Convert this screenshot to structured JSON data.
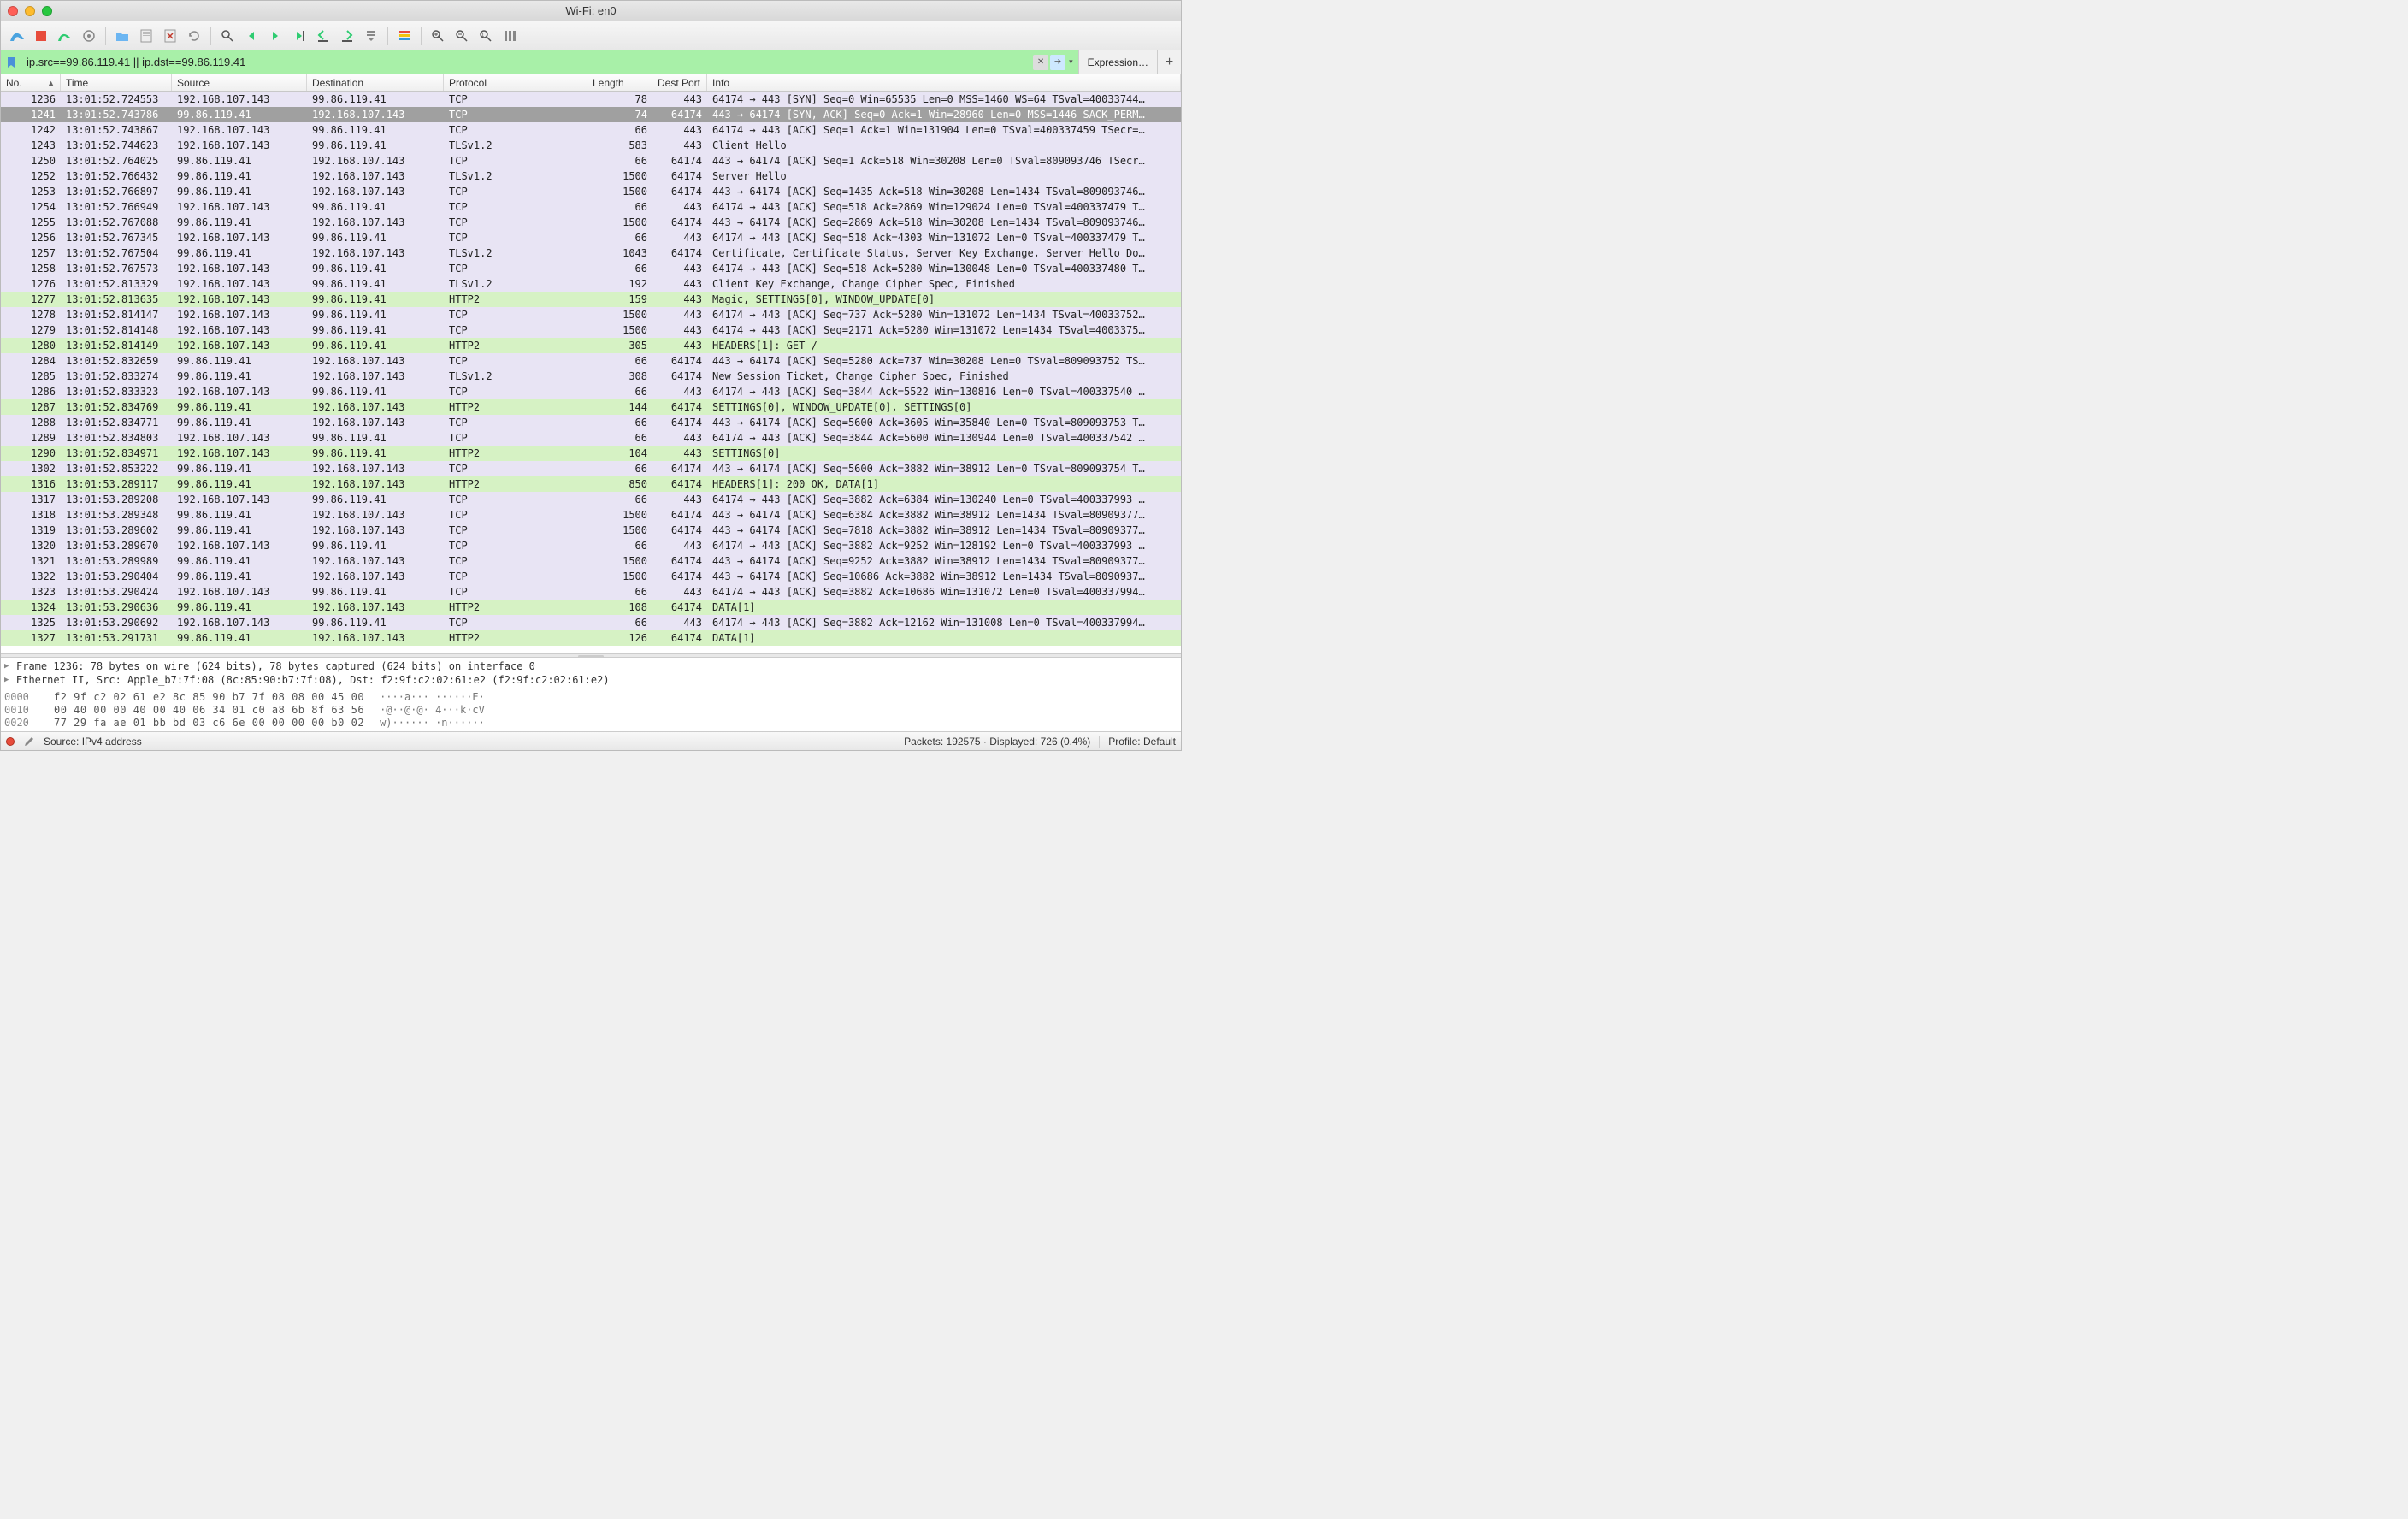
{
  "window": {
    "title": "Wi-Fi: en0"
  },
  "filter": {
    "value": "ip.src==99.86.119.41 || ip.dst==99.86.119.41",
    "expression_label": "Expression…"
  },
  "columns": {
    "no": "No.",
    "time": "Time",
    "source": "Source",
    "destination": "Destination",
    "protocol": "Protocol",
    "length": "Length",
    "dest_port": "Dest Port",
    "info": "Info"
  },
  "packets": [
    {
      "no": 1236,
      "time": "13:01:52.724553",
      "src": "192.168.107.143",
      "dst": "99.86.119.41",
      "proto": "TCP",
      "len": 78,
      "port": 443,
      "info": "64174 → 443 [SYN] Seq=0 Win=65535 Len=0 MSS=1460 WS=64 TSval=40033744…",
      "cls": "row-lav"
    },
    {
      "no": 1241,
      "time": "13:01:52.743786",
      "src": "99.86.119.41",
      "dst": "192.168.107.143",
      "proto": "TCP",
      "len": 74,
      "port": 64174,
      "info": "443 → 64174 [SYN, ACK] Seq=0 Ack=1 Win=28960 Len=0 MSS=1446 SACK_PERM…",
      "cls": "row-sel"
    },
    {
      "no": 1242,
      "time": "13:01:52.743867",
      "src": "192.168.107.143",
      "dst": "99.86.119.41",
      "proto": "TCP",
      "len": 66,
      "port": 443,
      "info": "64174 → 443 [ACK] Seq=1 Ack=1 Win=131904 Len=0 TSval=400337459 TSecr=…",
      "cls": "row-lav"
    },
    {
      "no": 1243,
      "time": "13:01:52.744623",
      "src": "192.168.107.143",
      "dst": "99.86.119.41",
      "proto": "TLSv1.2",
      "len": 583,
      "port": 443,
      "info": "Client Hello",
      "cls": "row-lav"
    },
    {
      "no": 1250,
      "time": "13:01:52.764025",
      "src": "99.86.119.41",
      "dst": "192.168.107.143",
      "proto": "TCP",
      "len": 66,
      "port": 64174,
      "info": "443 → 64174 [ACK] Seq=1 Ack=518 Win=30208 Len=0 TSval=809093746 TSecr…",
      "cls": "row-lav"
    },
    {
      "no": 1252,
      "time": "13:01:52.766432",
      "src": "99.86.119.41",
      "dst": "192.168.107.143",
      "proto": "TLSv1.2",
      "len": 1500,
      "port": 64174,
      "info": "Server Hello",
      "cls": "row-lav"
    },
    {
      "no": 1253,
      "time": "13:01:52.766897",
      "src": "99.86.119.41",
      "dst": "192.168.107.143",
      "proto": "TCP",
      "len": 1500,
      "port": 64174,
      "info": "443 → 64174 [ACK] Seq=1435 Ack=518 Win=30208 Len=1434 TSval=809093746…",
      "cls": "row-lav"
    },
    {
      "no": 1254,
      "time": "13:01:52.766949",
      "src": "192.168.107.143",
      "dst": "99.86.119.41",
      "proto": "TCP",
      "len": 66,
      "port": 443,
      "info": "64174 → 443 [ACK] Seq=518 Ack=2869 Win=129024 Len=0 TSval=400337479 T…",
      "cls": "row-lav"
    },
    {
      "no": 1255,
      "time": "13:01:52.767088",
      "src": "99.86.119.41",
      "dst": "192.168.107.143",
      "proto": "TCP",
      "len": 1500,
      "port": 64174,
      "info": "443 → 64174 [ACK] Seq=2869 Ack=518 Win=30208 Len=1434 TSval=809093746…",
      "cls": "row-lav"
    },
    {
      "no": 1256,
      "time": "13:01:52.767345",
      "src": "192.168.107.143",
      "dst": "99.86.119.41",
      "proto": "TCP",
      "len": 66,
      "port": 443,
      "info": "64174 → 443 [ACK] Seq=518 Ack=4303 Win=131072 Len=0 TSval=400337479 T…",
      "cls": "row-lav"
    },
    {
      "no": 1257,
      "time": "13:01:52.767504",
      "src": "99.86.119.41",
      "dst": "192.168.107.143",
      "proto": "TLSv1.2",
      "len": 1043,
      "port": 64174,
      "info": "Certificate, Certificate Status, Server Key Exchange, Server Hello Do…",
      "cls": "row-lav"
    },
    {
      "no": 1258,
      "time": "13:01:52.767573",
      "src": "192.168.107.143",
      "dst": "99.86.119.41",
      "proto": "TCP",
      "len": 66,
      "port": 443,
      "info": "64174 → 443 [ACK] Seq=518 Ack=5280 Win=130048 Len=0 TSval=400337480 T…",
      "cls": "row-lav"
    },
    {
      "no": 1276,
      "time": "13:01:52.813329",
      "src": "192.168.107.143",
      "dst": "99.86.119.41",
      "proto": "TLSv1.2",
      "len": 192,
      "port": 443,
      "info": "Client Key Exchange, Change Cipher Spec, Finished",
      "cls": "row-lav"
    },
    {
      "no": 1277,
      "time": "13:01:52.813635",
      "src": "192.168.107.143",
      "dst": "99.86.119.41",
      "proto": "HTTP2",
      "len": 159,
      "port": 443,
      "info": "Magic, SETTINGS[0], WINDOW_UPDATE[0]",
      "cls": "row-grn"
    },
    {
      "no": 1278,
      "time": "13:01:52.814147",
      "src": "192.168.107.143",
      "dst": "99.86.119.41",
      "proto": "TCP",
      "len": 1500,
      "port": 443,
      "info": "64174 → 443 [ACK] Seq=737 Ack=5280 Win=131072 Len=1434 TSval=40033752…",
      "cls": "row-lav"
    },
    {
      "no": 1279,
      "time": "13:01:52.814148",
      "src": "192.168.107.143",
      "dst": "99.86.119.41",
      "proto": "TCP",
      "len": 1500,
      "port": 443,
      "info": "64174 → 443 [ACK] Seq=2171 Ack=5280 Win=131072 Len=1434 TSval=4003375…",
      "cls": "row-lav"
    },
    {
      "no": 1280,
      "time": "13:01:52.814149",
      "src": "192.168.107.143",
      "dst": "99.86.119.41",
      "proto": "HTTP2",
      "len": 305,
      "port": 443,
      "info": "HEADERS[1]: GET /",
      "cls": "row-grn"
    },
    {
      "no": 1284,
      "time": "13:01:52.832659",
      "src": "99.86.119.41",
      "dst": "192.168.107.143",
      "proto": "TCP",
      "len": 66,
      "port": 64174,
      "info": "443 → 64174 [ACK] Seq=5280 Ack=737 Win=30208 Len=0 TSval=809093752 TS…",
      "cls": "row-lav"
    },
    {
      "no": 1285,
      "time": "13:01:52.833274",
      "src": "99.86.119.41",
      "dst": "192.168.107.143",
      "proto": "TLSv1.2",
      "len": 308,
      "port": 64174,
      "info": "New Session Ticket, Change Cipher Spec, Finished",
      "cls": "row-lav"
    },
    {
      "no": 1286,
      "time": "13:01:52.833323",
      "src": "192.168.107.143",
      "dst": "99.86.119.41",
      "proto": "TCP",
      "len": 66,
      "port": 443,
      "info": "64174 → 443 [ACK] Seq=3844 Ack=5522 Win=130816 Len=0 TSval=400337540 …",
      "cls": "row-lav"
    },
    {
      "no": 1287,
      "time": "13:01:52.834769",
      "src": "99.86.119.41",
      "dst": "192.168.107.143",
      "proto": "HTTP2",
      "len": 144,
      "port": 64174,
      "info": "SETTINGS[0], WINDOW_UPDATE[0], SETTINGS[0]",
      "cls": "row-grn"
    },
    {
      "no": 1288,
      "time": "13:01:52.834771",
      "src": "99.86.119.41",
      "dst": "192.168.107.143",
      "proto": "TCP",
      "len": 66,
      "port": 64174,
      "info": "443 → 64174 [ACK] Seq=5600 Ack=3605 Win=35840 Len=0 TSval=809093753 T…",
      "cls": "row-lav"
    },
    {
      "no": 1289,
      "time": "13:01:52.834803",
      "src": "192.168.107.143",
      "dst": "99.86.119.41",
      "proto": "TCP",
      "len": 66,
      "port": 443,
      "info": "64174 → 443 [ACK] Seq=3844 Ack=5600 Win=130944 Len=0 TSval=400337542 …",
      "cls": "row-lav"
    },
    {
      "no": 1290,
      "time": "13:01:52.834971",
      "src": "192.168.107.143",
      "dst": "99.86.119.41",
      "proto": "HTTP2",
      "len": 104,
      "port": 443,
      "info": "SETTINGS[0]",
      "cls": "row-grn"
    },
    {
      "no": 1302,
      "time": "13:01:52.853222",
      "src": "99.86.119.41",
      "dst": "192.168.107.143",
      "proto": "TCP",
      "len": 66,
      "port": 64174,
      "info": "443 → 64174 [ACK] Seq=5600 Ack=3882 Win=38912 Len=0 TSval=809093754 T…",
      "cls": "row-lav"
    },
    {
      "no": 1316,
      "time": "13:01:53.289117",
      "src": "99.86.119.41",
      "dst": "192.168.107.143",
      "proto": "HTTP2",
      "len": 850,
      "port": 64174,
      "info": "HEADERS[1]: 200 OK, DATA[1]",
      "cls": "row-grn"
    },
    {
      "no": 1317,
      "time": "13:01:53.289208",
      "src": "192.168.107.143",
      "dst": "99.86.119.41",
      "proto": "TCP",
      "len": 66,
      "port": 443,
      "info": "64174 → 443 [ACK] Seq=3882 Ack=6384 Win=130240 Len=0 TSval=400337993 …",
      "cls": "row-lav"
    },
    {
      "no": 1318,
      "time": "13:01:53.289348",
      "src": "99.86.119.41",
      "dst": "192.168.107.143",
      "proto": "TCP",
      "len": 1500,
      "port": 64174,
      "info": "443 → 64174 [ACK] Seq=6384 Ack=3882 Win=38912 Len=1434 TSval=80909377…",
      "cls": "row-lav"
    },
    {
      "no": 1319,
      "time": "13:01:53.289602",
      "src": "99.86.119.41",
      "dst": "192.168.107.143",
      "proto": "TCP",
      "len": 1500,
      "port": 64174,
      "info": "443 → 64174 [ACK] Seq=7818 Ack=3882 Win=38912 Len=1434 TSval=80909377…",
      "cls": "row-lav"
    },
    {
      "no": 1320,
      "time": "13:01:53.289670",
      "src": "192.168.107.143",
      "dst": "99.86.119.41",
      "proto": "TCP",
      "len": 66,
      "port": 443,
      "info": "64174 → 443 [ACK] Seq=3882 Ack=9252 Win=128192 Len=0 TSval=400337993 …",
      "cls": "row-lav"
    },
    {
      "no": 1321,
      "time": "13:01:53.289989",
      "src": "99.86.119.41",
      "dst": "192.168.107.143",
      "proto": "TCP",
      "len": 1500,
      "port": 64174,
      "info": "443 → 64174 [ACK] Seq=9252 Ack=3882 Win=38912 Len=1434 TSval=80909377…",
      "cls": "row-lav"
    },
    {
      "no": 1322,
      "time": "13:01:53.290404",
      "src": "99.86.119.41",
      "dst": "192.168.107.143",
      "proto": "TCP",
      "len": 1500,
      "port": 64174,
      "info": "443 → 64174 [ACK] Seq=10686 Ack=3882 Win=38912 Len=1434 TSval=8090937…",
      "cls": "row-lav"
    },
    {
      "no": 1323,
      "time": "13:01:53.290424",
      "src": "192.168.107.143",
      "dst": "99.86.119.41",
      "proto": "TCP",
      "len": 66,
      "port": 443,
      "info": "64174 → 443 [ACK] Seq=3882 Ack=10686 Win=131072 Len=0 TSval=400337994…",
      "cls": "row-lav"
    },
    {
      "no": 1324,
      "time": "13:01:53.290636",
      "src": "99.86.119.41",
      "dst": "192.168.107.143",
      "proto": "HTTP2",
      "len": 108,
      "port": 64174,
      "info": "DATA[1]",
      "cls": "row-grn"
    },
    {
      "no": 1325,
      "time": "13:01:53.290692",
      "src": "192.168.107.143",
      "dst": "99.86.119.41",
      "proto": "TCP",
      "len": 66,
      "port": 443,
      "info": "64174 → 443 [ACK] Seq=3882 Ack=12162 Win=131008 Len=0 TSval=400337994…",
      "cls": "row-lav"
    },
    {
      "no": 1327,
      "time": "13:01:53.291731",
      "src": "99.86.119.41",
      "dst": "192.168.107.143",
      "proto": "HTTP2",
      "len": 126,
      "port": 64174,
      "info": "DATA[1]",
      "cls": "row-grn"
    }
  ],
  "details": {
    "line1": "Frame 1236: 78 bytes on wire (624 bits), 78 bytes captured (624 bits) on interface 0",
    "line2": "Ethernet II, Src: Apple_b7:7f:08 (8c:85:90:b7:7f:08), Dst: f2:9f:c2:02:61:e2 (f2:9f:c2:02:61:e2)"
  },
  "hex": [
    {
      "off": "0000",
      "bytes": "f2 9f c2 02 61 e2 8c 85  90 b7 7f 08 08 00 45 00",
      "ascii": "····a··· ······E·"
    },
    {
      "off": "0010",
      "bytes": "00 40 00 00 40 00 40 06  34 01 c0 a8 6b 8f 63 56",
      "ascii": "·@··@·@· 4···k·cV"
    },
    {
      "off": "0020",
      "bytes": "77 29 fa ae 01 bb bd 03  c6 6e 00 00 00 00 b0 02",
      "ascii": "w)······ ·n······"
    }
  ],
  "status": {
    "source": "Source: IPv4 address",
    "packets": "Packets: 192575 · Displayed: 726 (0.4%)",
    "profile": "Profile: Default"
  }
}
